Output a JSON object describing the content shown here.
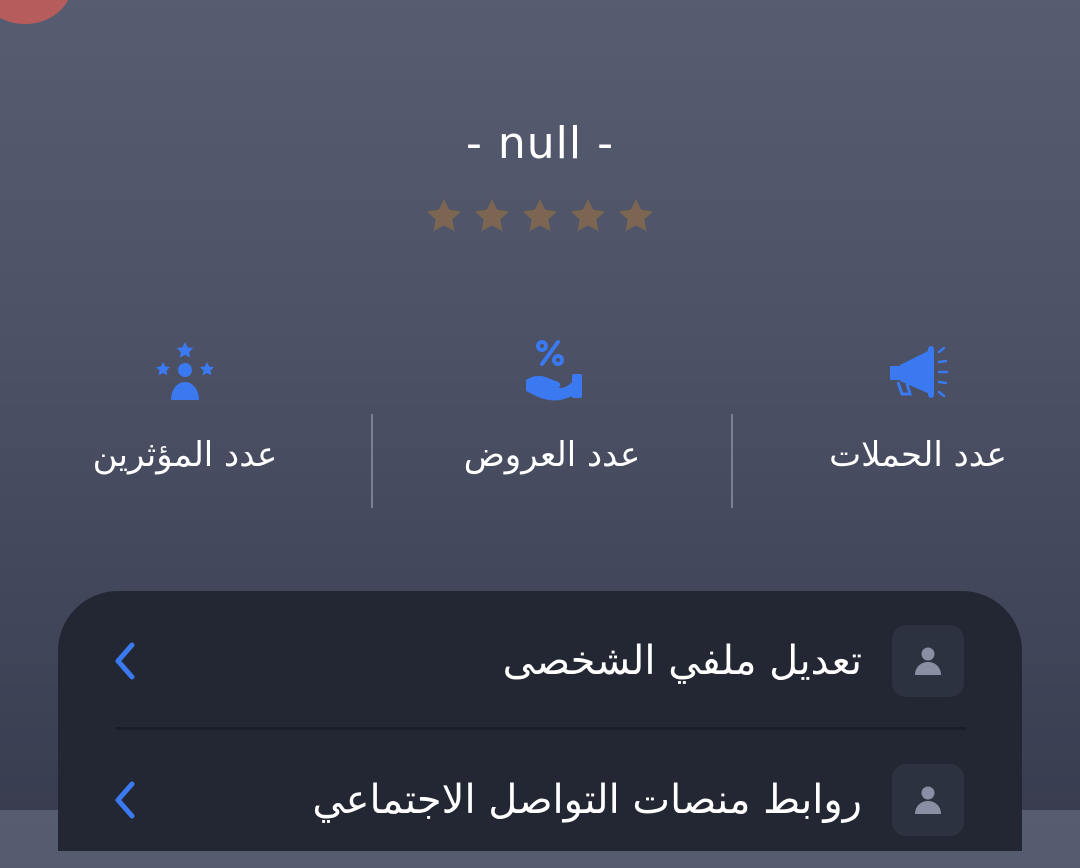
{
  "profile": {
    "name": "- null -",
    "rating": 0,
    "rating_max": 5
  },
  "stats": [
    {
      "label": "عدد الحملات",
      "icon": "megaphone-icon"
    },
    {
      "label": "عدد العروض",
      "icon": "offer-hand-percent-icon"
    },
    {
      "label": "عدد المؤثرين",
      "icon": "influencer-stars-icon"
    }
  ],
  "menu": {
    "items": [
      {
        "label": "تعديل ملفي الشخصى",
        "icon": "user-icon"
      },
      {
        "label": "روابط منصات التواصل الاجتماعي",
        "icon": "user-icon"
      }
    ]
  },
  "colors": {
    "accent_blue": "#3a79f0",
    "star_inactive": "#7c6651",
    "card_background": "#222733",
    "avatar_red": "#b75c5c"
  }
}
